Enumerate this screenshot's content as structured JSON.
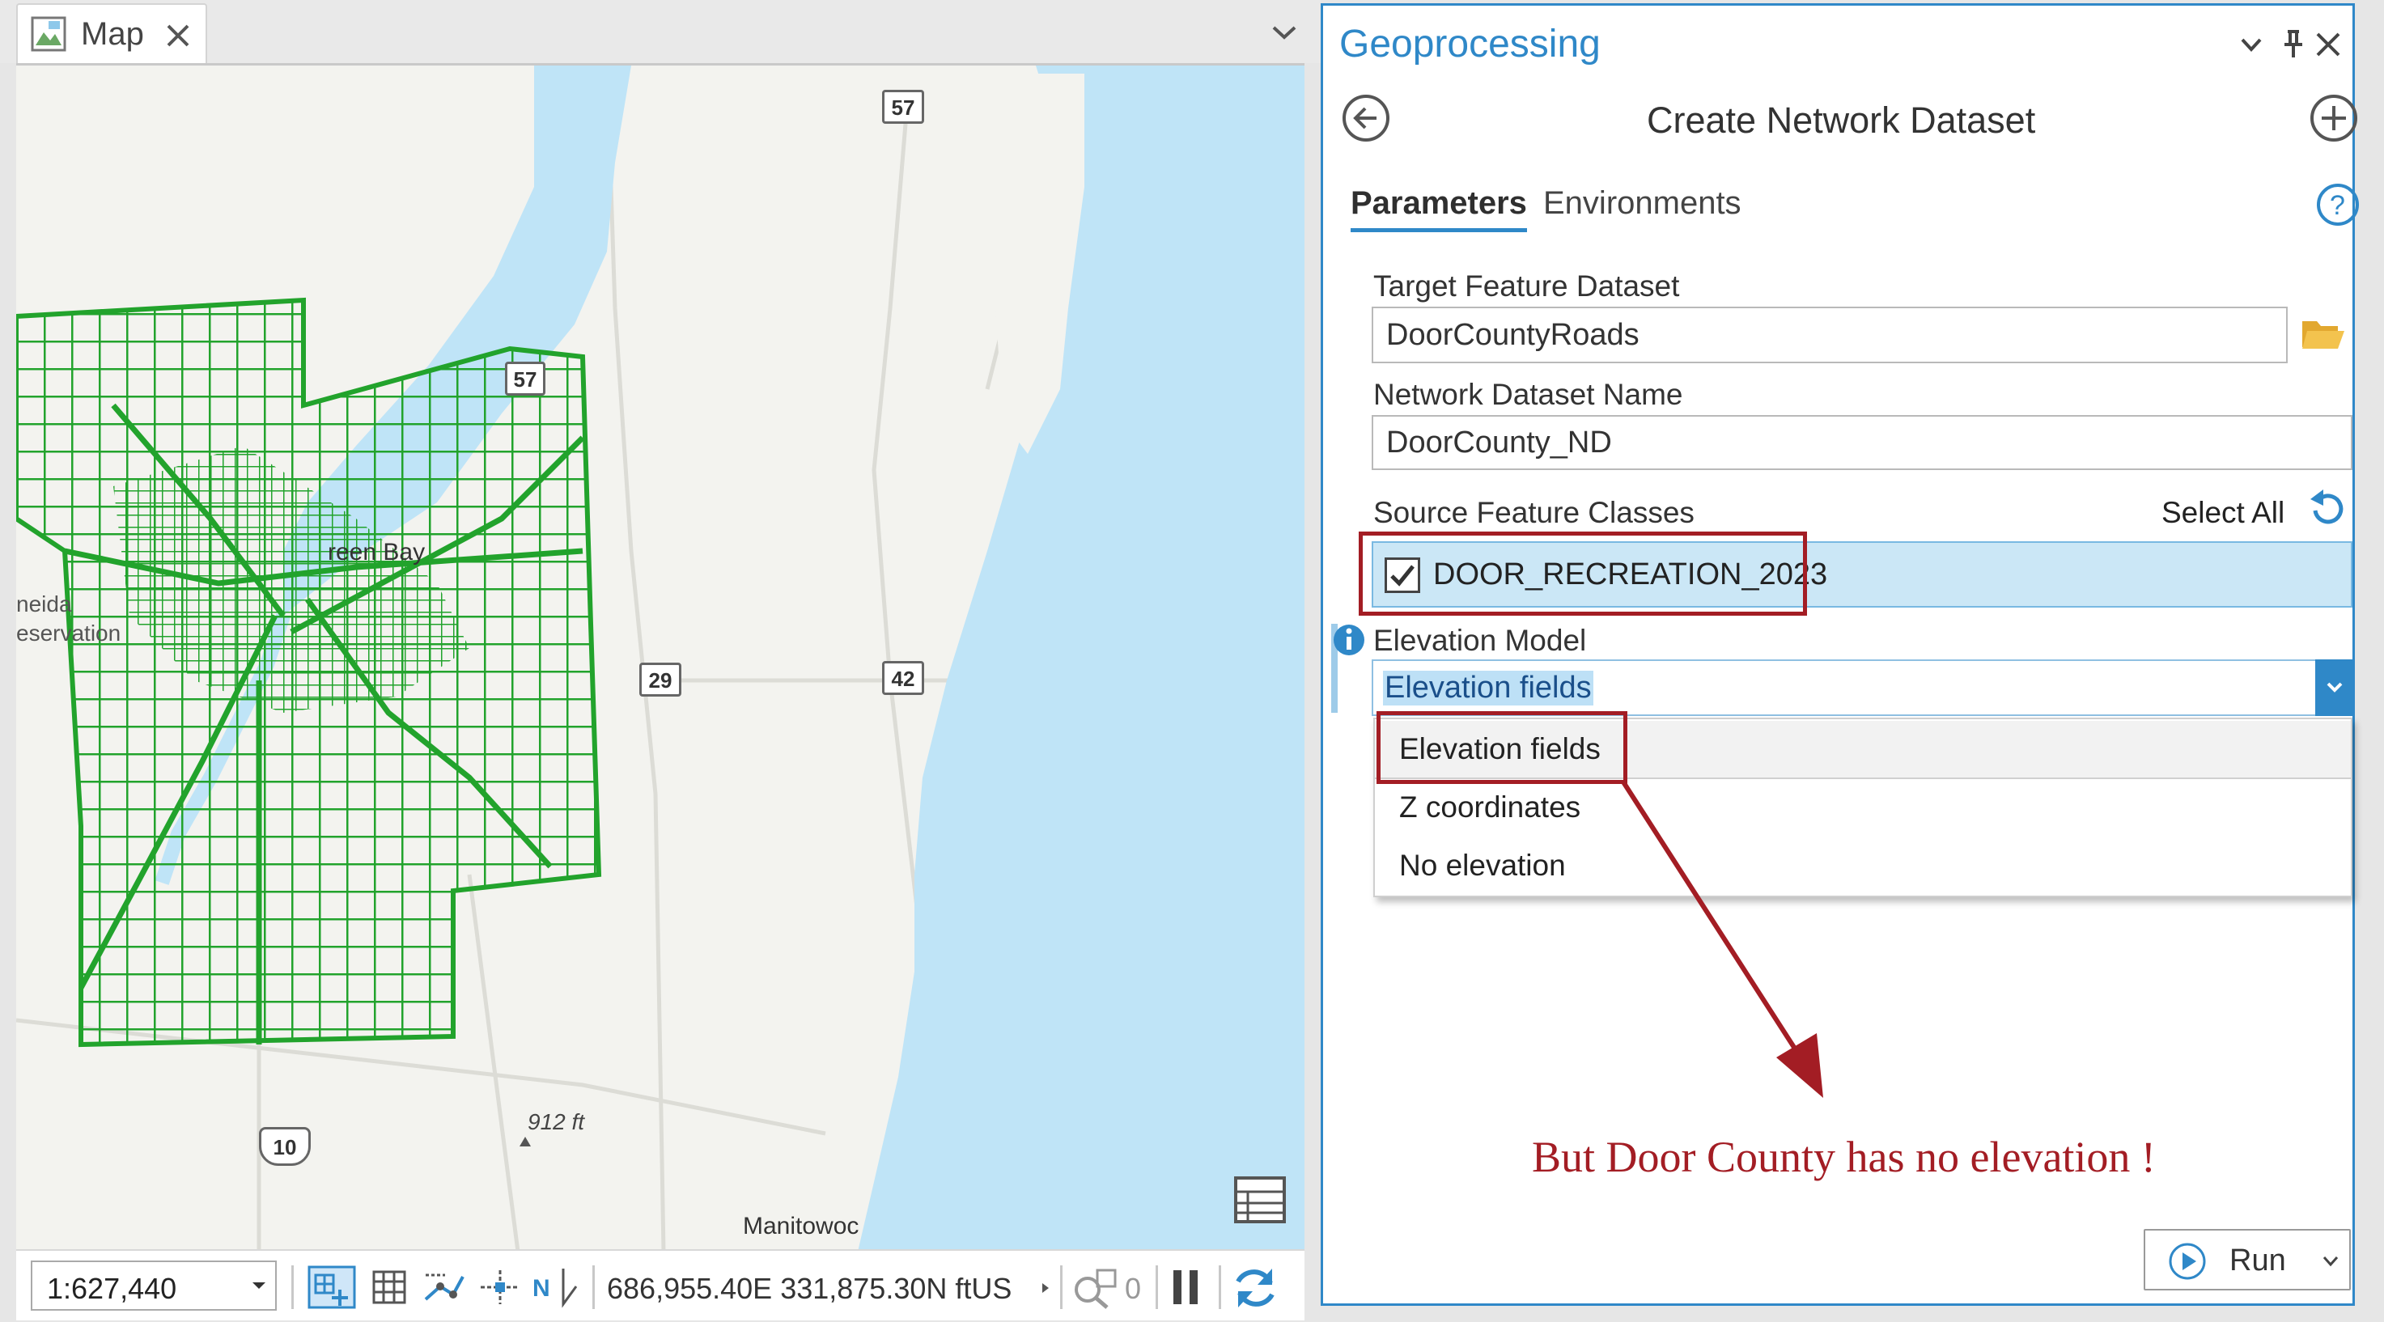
{
  "map_tab": {
    "title": "Map",
    "icon": "map-icon"
  },
  "map_labels": {
    "city_partial": "reen Bay",
    "reservation_line1": "neida",
    "reservation_line2": "eservation",
    "manitowoc": "Manitowoc",
    "elevation": "912 ft"
  },
  "shields": {
    "h57_top": "57",
    "h57_mid": "57",
    "h29": "29",
    "h42": "42",
    "us10": "10"
  },
  "statusbar": {
    "scale": "1:627,440",
    "coordinates": "686,955.40E 331,875.30N ftUS",
    "selected_count": "0"
  },
  "geoprocessing": {
    "title": "Geoprocessing",
    "tool_title": "Create Network Dataset",
    "tabs": [
      {
        "label": "Parameters",
        "active": true
      },
      {
        "label": "Environments",
        "active": false
      }
    ],
    "target_feature_dataset": {
      "label": "Target Feature Dataset",
      "value": "DoorCountyRoads"
    },
    "network_dataset_name": {
      "label": "Network Dataset Name",
      "value": "DoorCounty_ND"
    },
    "source_feature_classes": {
      "label": "Source Feature Classes",
      "select_all": "Select All",
      "items": [
        {
          "label": "DOOR_RECREATION_2023",
          "checked": true
        }
      ]
    },
    "elevation_model": {
      "label": "Elevation Model",
      "value": "Elevation fields",
      "options": [
        "Elevation fields",
        "Z coordinates",
        "No elevation"
      ]
    },
    "run_button": "Run"
  },
  "annotation": {
    "text": "But Door County has no elevation !",
    "color": "#a31d24"
  },
  "colors": {
    "accent": "#2f88c8",
    "roads": "#22a32c",
    "water": "#bfe4f7",
    "annotation": "#a31d24"
  }
}
